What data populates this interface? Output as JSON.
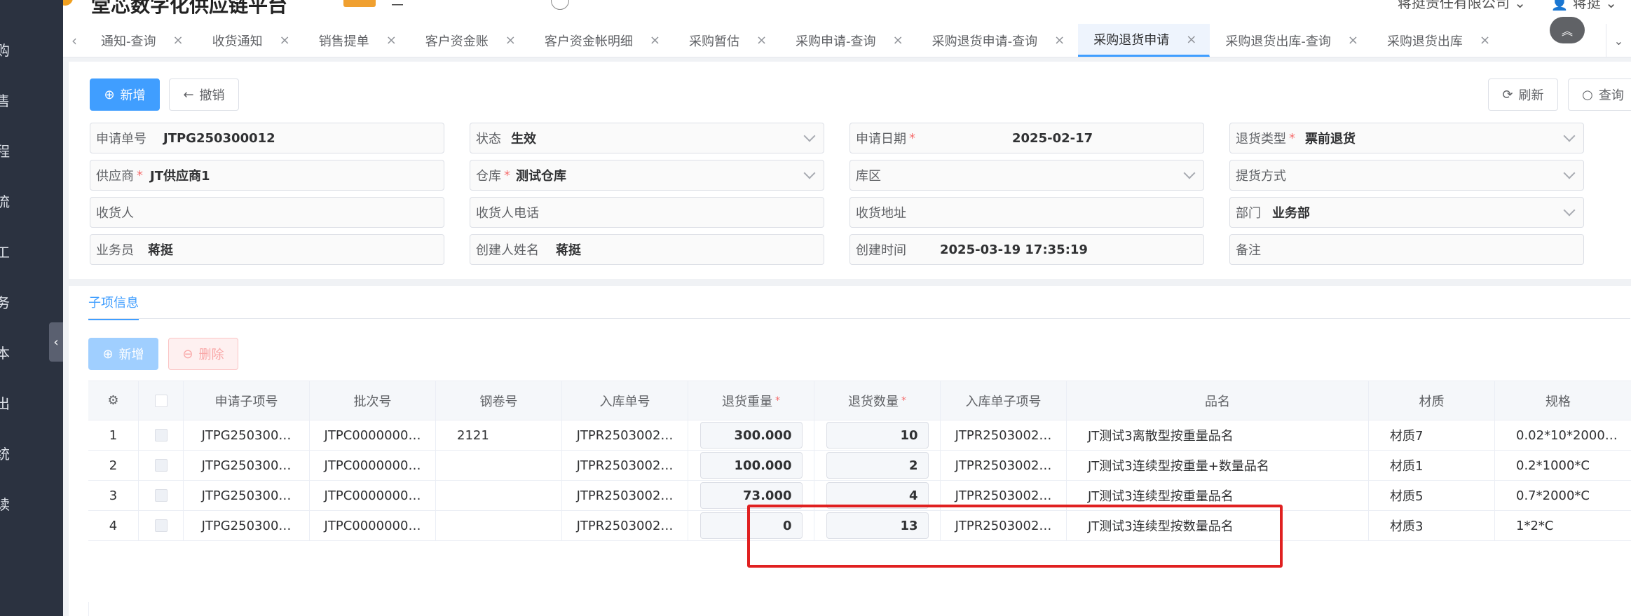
{
  "header": {
    "app_title": "堂芯数字化供应链平台",
    "badge": "",
    "menu_text": "二",
    "company": "蒋挺责任有限公司",
    "user": "蒋挺"
  },
  "sidebar": {
    "chars": [
      "购",
      "售",
      "程",
      "流",
      "工",
      "务",
      "本",
      "出",
      "统",
      "读"
    ]
  },
  "tabs": {
    "items": [
      {
        "label": "通知-查询"
      },
      {
        "label": "收货通知"
      },
      {
        "label": "销售提单"
      },
      {
        "label": "客户资金账"
      },
      {
        "label": "客户资金帐明细"
      },
      {
        "label": "采购暂估"
      },
      {
        "label": "采购申请-查询"
      },
      {
        "label": "采购退货申请-查询"
      },
      {
        "label": "采购退货申请"
      },
      {
        "label": "采购退货出库-查询"
      },
      {
        "label": "采购退货出库"
      }
    ],
    "active_label": "采购退货申请"
  },
  "toolbar": {
    "add_label": "新增",
    "revoke_label": "撤销",
    "refresh_label": "刷新",
    "query_label": "查询"
  },
  "form": {
    "apply_no": {
      "label": "申请单号",
      "value": "JTPG250300012"
    },
    "status": {
      "label": "状态",
      "value": "生效"
    },
    "apply_date": {
      "label": "申请日期",
      "value": "2025-02-17"
    },
    "return_type": {
      "label": "退货类型",
      "value": "票前退货"
    },
    "supplier": {
      "label": "供应商",
      "value": "JT供应商1"
    },
    "warehouse": {
      "label": "仓库",
      "value": "测试仓库"
    },
    "zone": {
      "label": "库区",
      "value": ""
    },
    "pickup": {
      "label": "提货方式",
      "value": ""
    },
    "receiver": {
      "label": "收货人",
      "value": ""
    },
    "receiver_phone": {
      "label": "收货人电话",
      "value": ""
    },
    "receiver_addr": {
      "label": "收货地址",
      "value": ""
    },
    "dept": {
      "label": "部门",
      "value": "业务部"
    },
    "salesman": {
      "label": "业务员",
      "value": "蒋挺"
    },
    "creator": {
      "label": "创建人姓名",
      "value": "蒋挺"
    },
    "created_at": {
      "label": "创建时间",
      "value": "2025-03-19 17:35:19"
    },
    "remark": {
      "label": "备注",
      "value": ""
    }
  },
  "sub": {
    "tab_label": "子项信息",
    "add_label": "新增",
    "delete_label": "删除"
  },
  "table": {
    "columns": [
      "申请子项号",
      "批次号",
      "钢卷号",
      "入库单号",
      "退货重量",
      "退货数量",
      "入库单子项号",
      "品名",
      "材质",
      "规格"
    ],
    "rows": [
      {
        "idx": "1",
        "sub_no": "JTPG250300…",
        "batch": "JTPC0000000…",
        "coil": "2121",
        "in_no": "JTPR2503002…",
        "weight": "300.000",
        "qty": "10",
        "in_sub": "JTPR2503002…",
        "name": "JT测试3离散型按重量品名",
        "material": "材质7",
        "spec": "0.02*10*2000…"
      },
      {
        "idx": "2",
        "sub_no": "JTPG250300…",
        "batch": "JTPC0000000…",
        "coil": "",
        "in_no": "JTPR2503002…",
        "weight": "100.000",
        "qty": "2",
        "in_sub": "JTPR2503002…",
        "name": "JT测试3连续型按重量+数量品名",
        "material": "材质1",
        "spec": "0.2*1000*C"
      },
      {
        "idx": "3",
        "sub_no": "JTPG250300…",
        "batch": "JTPC0000000…",
        "coil": "",
        "in_no": "JTPR2503002…",
        "weight": "73.000",
        "qty": "4",
        "in_sub": "JTPR2503002…",
        "name": "JT测试3连续型按重量品名",
        "material": "材质5",
        "spec": "0.7*2000*C"
      },
      {
        "idx": "4",
        "sub_no": "JTPG250300…",
        "batch": "JTPC0000000…",
        "coil": "",
        "in_no": "JTPR2503002…",
        "weight": "0",
        "qty": "13",
        "in_sub": "JTPR2503002…",
        "name": "JT测试3连续型按数量品名",
        "material": "材质3",
        "spec": "1*2*C"
      }
    ]
  },
  "colors": {
    "accent": "#409eff",
    "highlight": "#e02020",
    "sidebar": "#2b3240"
  }
}
